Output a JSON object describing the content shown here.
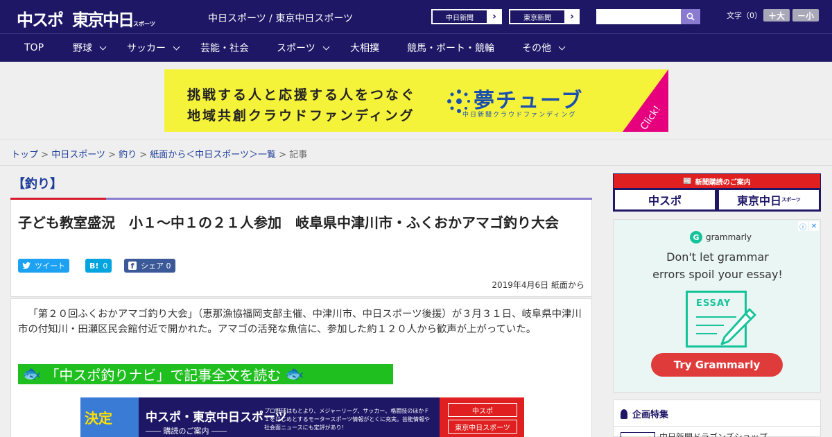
{
  "header": {
    "logo_main": "中スポ",
    "logo_second": "東京中日",
    "logo_small": "スポーツ",
    "site_title": "中日スポーツ / 東京中日スポーツ",
    "ext_links": [
      "中日新聞",
      "東京新聞"
    ],
    "search_placeholder": "",
    "font_size_label": "文字（0）",
    "font_larger": "＋大",
    "font_smaller": "－小"
  },
  "nav": {
    "items": [
      {
        "label": "TOP",
        "has_menu": false
      },
      {
        "label": "野球",
        "has_menu": true
      },
      {
        "label": "サッカー",
        "has_menu": true
      },
      {
        "label": "芸能・社会",
        "has_menu": false
      },
      {
        "label": "スポーツ",
        "has_menu": true
      },
      {
        "label": "大相撲",
        "has_menu": false
      },
      {
        "label": "競馬・ボート・競輪",
        "has_menu": false
      },
      {
        "label": "その他",
        "has_menu": true
      }
    ]
  },
  "banner": {
    "line1": "挑戦する人と応援する人をつなぐ",
    "line2": "地域共創クラウドファンディング",
    "brand": "夢チューブ",
    "brand_sub": "中日新聞クラウドファンディング",
    "click": "Click!",
    "bg_color": "#f5f23a"
  },
  "breadcrumb": {
    "items": [
      "トップ",
      "中日スポーツ",
      "釣り",
      "紙面から＜中日スポーツ＞一覧"
    ],
    "current": "記事"
  },
  "article": {
    "category": "【釣り】",
    "title": "子ども教室盛況　小１～中１の２１人参加　岐阜県中津川市・ふくおかアマゴ釣り大会",
    "share": {
      "tweet": "ツイート",
      "hatena_icon": "B!",
      "hatena_count": "0",
      "fb_icon": "f",
      "fb_label": "シェア",
      "fb_count": "0"
    },
    "date": "2019年4月6日 紙面から",
    "body": "「第２０回ふくおかアマゴ釣り大会」（恵那漁協福岡支部主催、中津川市、中日スポーツ後援）が３月３１日、岐阜県中津川市の付知川・田瀬区民会館付近で開かれた。アマゴの活発な魚信に、参加した約１２０人から歓声が上がっていた。",
    "navi_link": "「中スポ釣りナビ」で記事全文を読む",
    "sub_banner": {
      "thumb_text": "決定",
      "title": "中スポ・東京中日スポーツ",
      "subtitle": "―― 購読のご案内 ――",
      "desc": "プロ野球はもとより、メジャーリーグ、サッカー、格闘技のほかＦ１をはじめとするモータースポーツ情報がとくに充実。芸能情報や社会面ニュースにも定評があり！",
      "btn1": "中スポ",
      "btn2": "東京中日スポーツ"
    }
  },
  "sidebar": {
    "subscription_header": "新聞購読のご案内",
    "sub_buttons": [
      "中スポ",
      "東京中日"
    ],
    "sub_small": "スポーツ",
    "ad": {
      "brand": "grammarly",
      "headline1": "Don't let grammar",
      "headline2": "errors spoil your essay!",
      "doc_label": "ESSAY",
      "cta": "Try Grammarly",
      "info_icon": "ⓘ",
      "close_icon": "✕"
    },
    "feature_title": "企画特集",
    "feature_item": "中日新聞ドラゴンズショップ"
  },
  "colors": {
    "header_bg": "#1d1766",
    "accent_red": "#d71a2a",
    "accent_purple": "#8a7bd1",
    "navi_green": "#1fbf1f",
    "twitter": "#1da1f2",
    "hatena": "#00a4de",
    "facebook": "#3b5998"
  }
}
